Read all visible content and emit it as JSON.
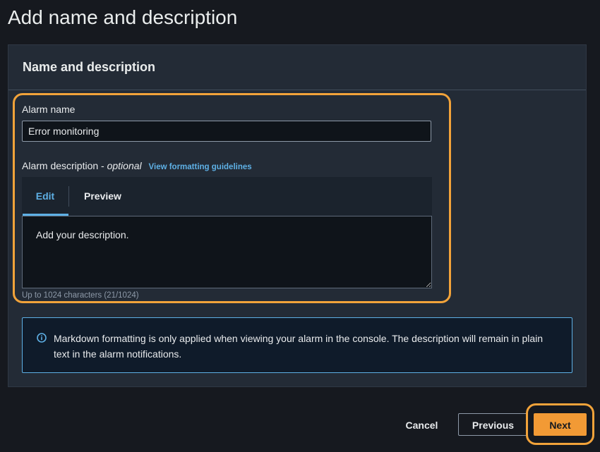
{
  "page": {
    "title": "Add name and description"
  },
  "panel": {
    "title": "Name and description"
  },
  "alarm_name": {
    "label": "Alarm name",
    "value": "Error monitoring"
  },
  "alarm_description": {
    "label": "Alarm description - ",
    "optional": "optional",
    "guidelines_link": "View formatting guidelines",
    "tabs": [
      "Edit",
      "Preview"
    ],
    "active_tab": "Edit",
    "value": "Add your description.",
    "hint": "Up to 1024 characters (21/1024)"
  },
  "info": {
    "icon": "info-circle-icon",
    "text": "Markdown formatting is only applied when viewing your alarm in the console. The description will remain in plain text in the alarm notifications."
  },
  "footer": {
    "cancel_label": "Cancel",
    "previous_label": "Previous",
    "next_label": "Next"
  },
  "colors": {
    "accent": "#f29a35",
    "link": "#5eb0e5",
    "highlight": "#f2a33a"
  }
}
